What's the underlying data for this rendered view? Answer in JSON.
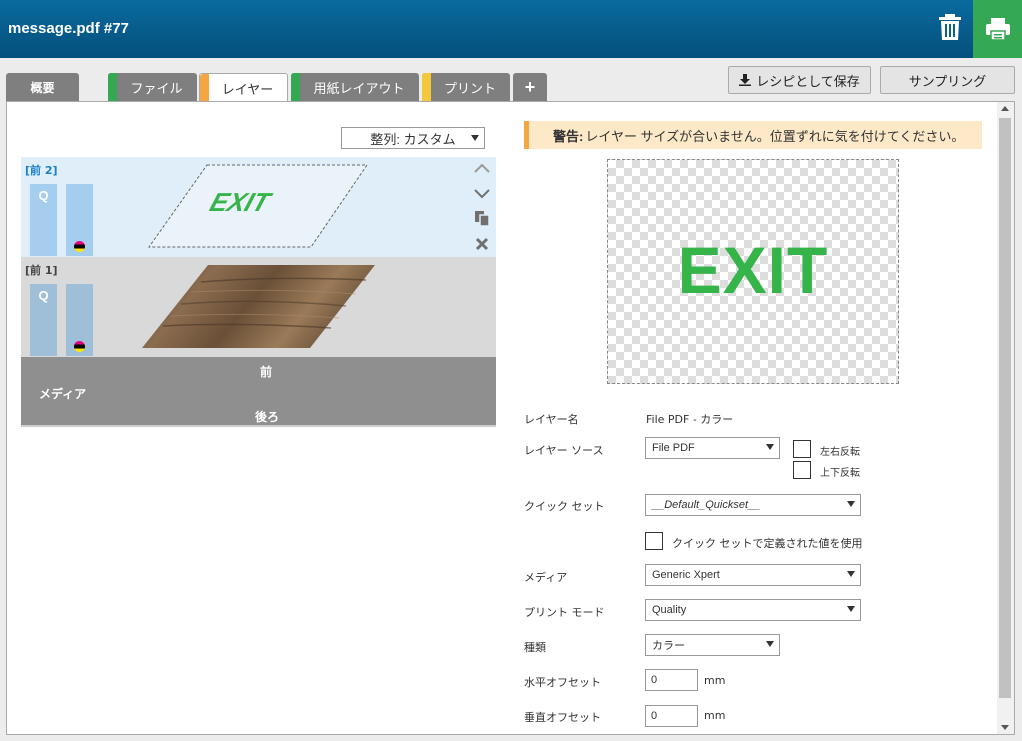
{
  "header": {
    "title": "message.pdf #77"
  },
  "tabs": [
    {
      "label": "概要",
      "color": ""
    },
    {
      "label": "ファイル",
      "color": "#35a853"
    },
    {
      "label": "レイヤー",
      "color": "#f4a641"
    },
    {
      "label": "用紙レイアウト",
      "color": "#35a853"
    },
    {
      "label": "プリント",
      "color": "#f5c73b"
    },
    {
      "label": "+",
      "color": ""
    }
  ],
  "toolbar": {
    "save_recipe": "レシピとして保存",
    "sampling": "サンプリング"
  },
  "left": {
    "align_select": "整列: カスタム",
    "layers": [
      {
        "label": "[前 2]",
        "q": "Q",
        "thumbnail_text": "EXIT"
      },
      {
        "label": "[前 1]",
        "q": "Q"
      }
    ],
    "media": {
      "front": "前",
      "media": "メディア",
      "back": "後ろ"
    }
  },
  "right": {
    "warning_title": "警告:",
    "warning_text": " レイヤー サイズが合いません。位置ずれに気を付けてください。",
    "preview_text": "EXIT",
    "layer_name_label": "レイヤー名",
    "layer_name_value": "File PDF - カラー",
    "layer_source_label": "レイヤー ソース",
    "layer_source_value": "File PDF",
    "flip_h": "左右反転",
    "flip_v": "上下反転",
    "quickset_label": "クイック セット",
    "quickset_value": "__Default_Quickset__",
    "use_quickset": "クイック セットで定義された値を使用",
    "media_label": "メディア",
    "media_value": "Generic Xpert",
    "print_mode_label": "プリント モード",
    "print_mode_value": "Quality",
    "type_label": "種類",
    "type_value": "カラー",
    "h_offset_label": "水平オフセット",
    "h_offset_value": "0",
    "v_offset_label": "垂直オフセット",
    "v_offset_value": "0",
    "unit": "mm"
  },
  "colors": {
    "header": "#04507c",
    "green": "#35a853",
    "orange": "#f4a641",
    "yellow": "#f5c73b",
    "layer_selected": "#dfeef9"
  }
}
